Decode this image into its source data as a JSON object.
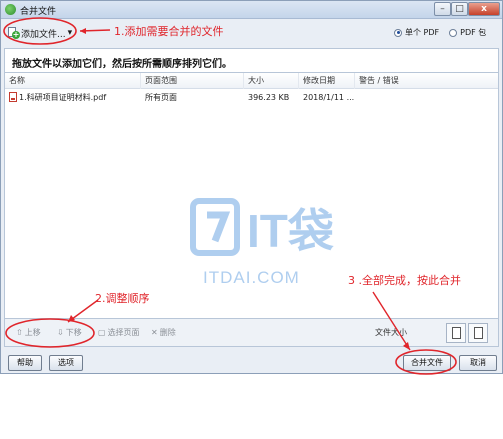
{
  "window": {
    "title": "合并文件",
    "controls": {
      "minimize": "–",
      "maximize": "□",
      "close": "x"
    }
  },
  "toolbar": {
    "add_files_label": "添加文件...",
    "add_files_arrow": "▾",
    "output_options": [
      {
        "label": "单个 PDF",
        "selected": true
      },
      {
        "label": "PDF 包",
        "selected": false
      }
    ]
  },
  "hint": "拖放文件以添加它们，然后按所需顺序排列它们。",
  "file_table": {
    "columns": [
      "名称",
      "页面范围",
      "大小",
      "修改日期",
      "警告 / 错误"
    ],
    "rows": [
      {
        "name": "1.科研项目证明材料.pdf",
        "page_range": "所有页面",
        "size": "396.23 KB",
        "modified": "2018/1/11 ...",
        "warning": ""
      }
    ]
  },
  "watermark": {
    "brand": "IT袋",
    "domain": "ITDAI.COM",
    "accent_color": "#2f7fd6"
  },
  "bottom_toolbar": {
    "move_up": "上移",
    "move_down": "下移",
    "select_pages": "选择页面",
    "delete": "删除",
    "file_size_label": "文件大小"
  },
  "footer": {
    "help": "帮助",
    "options": "选项",
    "merge": "合并文件",
    "cancel": "取消"
  },
  "annotations": {
    "step1": "1.添加需要合并的文件",
    "step2": "2.调整顺序",
    "step3": "3 .全部完成，按此合并",
    "color": "#e0252b"
  }
}
